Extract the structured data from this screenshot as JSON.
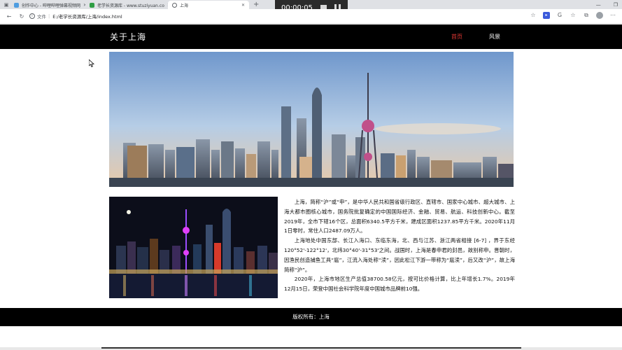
{
  "browser": {
    "tabs": [
      {
        "title": "创作中心 - 哔哩哔哩弹幕视频网",
        "favicon_color": "#4f9de0"
      },
      {
        "title": "老学长资源库 - www.stuziyuan.co",
        "favicon_color": "#2f9e44"
      },
      {
        "title": "上海",
        "favicon_color": "#5f6368"
      }
    ],
    "new_tab": "+",
    "address": {
      "scheme": "文件",
      "path": "E:/老学长资源库/上海/index.html"
    }
  },
  "recorder": {
    "time": "00:00:05"
  },
  "site": {
    "title": "关于上海",
    "nav": [
      {
        "label": "首页",
        "color": "#e53935"
      },
      {
        "label": "风景",
        "color": "#ffffff"
      }
    ],
    "paragraphs": [
      "上海，简称“沪”或“申”，是中华人民共和国省级行政区、直辖市、国家中心城市、超大城市、上海大都市圈核心城市，国务院批复确定的中国国际经济、金融、贸易、航运、科技创新中心。截至2019年，全市下辖16个区，总面积6340.5平方千米，建成区面积1237.85平方千米。2020年11月1日零时，常住人口2487.09万人。",
      "上海地处中国东部、长江入海口、东临东海，北、西与江苏、浙江两省相接 [6-7] ，界于东经120°52'-122°12'，北纬30°40'-31°53'之间。战国时，上海是春申君的封邑，故别称申。晋朝时，因渔民创造捕鱼工具“扈”，江流入海处称“渎”，因此松江下游一带称为“扈渎”，后又改“沪”，故上海简称“沪”。",
      "2020年，上海市地区生产总值38700.58亿元，按可比价格计算，比上年增长1.7%。2019年12月15日，荣登中国社会科学院年度中国城市品牌前10强。"
    ],
    "footer": "版权所有：上海"
  }
}
